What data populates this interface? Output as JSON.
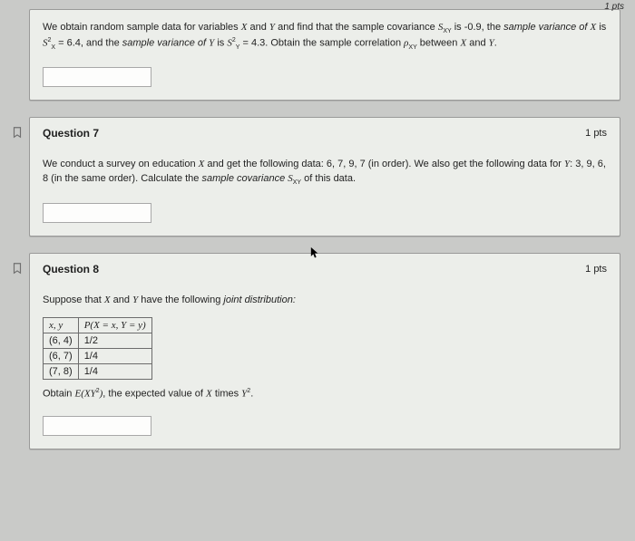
{
  "page_top_right": "1 pts",
  "q_prev": {
    "prompt_a": "We obtain random sample data for variables ",
    "X": "X",
    "and1": " and ",
    "Y": "Y",
    "prompt_b": " and find that the sample covariance ",
    "Sxy": "S",
    "Sxy_sub": "XY",
    "is1": " is -0.9, the ",
    "sv_of_x": "sample variance of ",
    "X2": "X",
    "is2": " is ",
    "Sx2": "S",
    "Sx2_exp": "2",
    "Sx2_sub": "X",
    "eq1": " = 6.4, and the ",
    "sv_of_y": "sample variance of ",
    "Y2": "Y",
    "is3": " is ",
    "Sy2": "S",
    "Sy2_exp": "2",
    "Sy2_sub": "Y",
    "eq2": " = 4.3. Obtain the sample correlation ",
    "rho": "ρ",
    "rho_sub": "XY",
    "between": " between ",
    "X3": "X",
    "and2": " and ",
    "Y3": "Y",
    "period": "."
  },
  "q7": {
    "title": "Question 7",
    "pts": "1 pts",
    "p1": "We conduct a survey on education ",
    "X": "X",
    "p2": " and get the following data: 6, 7, 9, 7 (in order). We also get the following data for ",
    "Y": "Y",
    "p3": ": 3, 9, 6, 8 (in the same order). Calculate the ",
    "sc": "sample covariance ",
    "Sxy": "S",
    "Sxy_sub": "XY",
    "p4": " of this data."
  },
  "q8": {
    "title": "Question 8",
    "pts": "1 pts",
    "p1": "Suppose that ",
    "X": "X",
    "and": " and ",
    "Y": "Y",
    "p2": " have the following ",
    "jd": "joint distribution:",
    "th_xy": "x, y",
    "th_p": "P(X = x, Y = y)",
    "r1a": "(6, 4)",
    "r1b": "1/2",
    "r2a": "(6, 7)",
    "r2b": "1/4",
    "r3a": "(7, 8)",
    "r3b": "1/4",
    "p3a": "Obtain ",
    "EXY2": "E(XY",
    "sq": "2",
    "EXY2b": ")",
    "p3b": ", the expected value of ",
    "X2": "X",
    "p3c": " times ",
    "Y2": "Y",
    "sq2": "2",
    "p3d": "."
  }
}
